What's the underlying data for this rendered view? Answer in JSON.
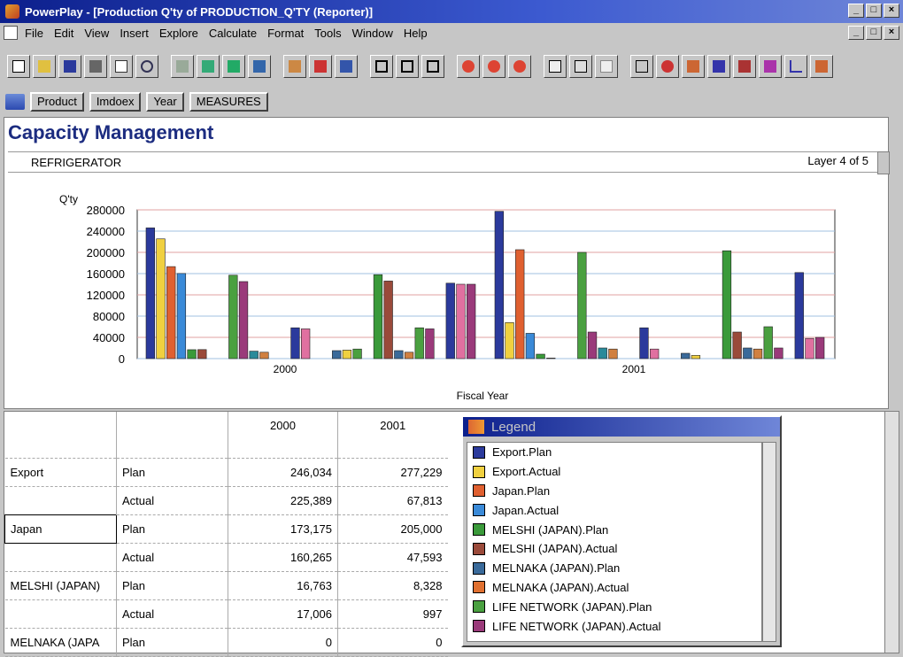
{
  "window": {
    "title": "PowerPlay - [Production Q'ty of PRODUCTION_Q'TY (Reporter)]",
    "controls": [
      "_",
      "×"
    ]
  },
  "menu": [
    "File",
    "Edit",
    "View",
    "Insert",
    "Explore",
    "Calculate",
    "Format",
    "Tools",
    "Window",
    "Help"
  ],
  "dimension_bar": {
    "dimensions": [
      "Product",
      "Imdoex",
      "Year",
      "MEASURES"
    ]
  },
  "report": {
    "title": "Capacity Management",
    "filter": "REFRIGERATOR",
    "layer": "Layer 4 of 5"
  },
  "colors": {
    "export_plan": "#2b3a9c",
    "export_actual": "#f0d040",
    "japan_plan": "#e06030",
    "japan_actual": "#3a8ad8",
    "melshi_plan": "#3a9a3a",
    "melshi_actual": "#9a4a3a",
    "melnaka_plan": "#3a6a9a",
    "melnaka_actual": "#e07030",
    "life_plan": "#4aa040",
    "life_actual": "#9a3a7a"
  },
  "chart_data": {
    "type": "bar",
    "xlabel": "Fiscal Year",
    "ylabel": "Q'ty",
    "ylim": [
      0,
      280000
    ],
    "yticks": [
      0,
      40000,
      80000,
      120000,
      160000,
      200000,
      240000,
      280000
    ],
    "yticks_labels": [
      "0",
      "40000",
      "80000",
      "120000",
      "160000",
      "200000",
      "240000",
      "280000"
    ],
    "categories": [
      "2000",
      "2001"
    ],
    "series": [
      {
        "values": [
          246034,
          277229
        ],
        "color": "#2b3a9c"
      },
      {
        "values": [
          225389,
          67813
        ],
        "color": "#f0d040"
      },
      {
        "values": [
          173175,
          205000
        ],
        "color": "#e06030"
      },
      {
        "values": [
          160265,
          47593
        ],
        "color": "#3a8ad8"
      },
      {
        "values": [
          16763,
          8328
        ],
        "color": "#3a9a3a"
      },
      {
        "values": [
          17006,
          997
        ],
        "color": "#9a4a3a"
      },
      {
        "values": [
          0,
          0
        ],
        "color": "#3a6a9a"
      },
      {
        "values": [
          0,
          0
        ],
        "color": "#e07030"
      },
      {
        "values": [
          157000,
          200000
        ],
        "color": "#4aa040"
      },
      {
        "values": [
          145000,
          50000
        ],
        "color": "#9a3a7a"
      },
      {
        "values": [
          14000,
          20000
        ],
        "color": "#2a8a9a"
      },
      {
        "values": [
          12000,
          18000
        ],
        "color": "#d08040"
      },
      {
        "values": [
          0,
          0
        ],
        "color": "#3a6a9a"
      },
      {
        "values": [
          0,
          0
        ],
        "color": "#e07030"
      },
      {
        "values": [
          58000,
          58000
        ],
        "color": "#2b3a9c"
      },
      {
        "values": [
          56000,
          18000
        ],
        "color": "#e070a0"
      },
      {
        "values": [
          0,
          0
        ],
        "color": "#3a6a9a"
      },
      {
        "values": [
          0,
          0
        ],
        "color": "#e07030"
      },
      {
        "values": [
          15000,
          10000
        ],
        "color": "#3a6a9a"
      },
      {
        "values": [
          16000,
          6000
        ],
        "color": "#f0d040"
      },
      {
        "values": [
          18000,
          0
        ],
        "color": "#4aa040"
      },
      {
        "values": [
          0,
          0
        ],
        "color": "#9a3a7a"
      },
      {
        "values": [
          158000,
          203000
        ],
        "color": "#3a9a3a"
      },
      {
        "values": [
          146000,
          50000
        ],
        "color": "#9a4a3a"
      },
      {
        "values": [
          15000,
          20000
        ],
        "color": "#3a6a9a"
      },
      {
        "values": [
          12000,
          18000
        ],
        "color": "#d08040"
      },
      {
        "values": [
          58000,
          60000
        ],
        "color": "#4aa040"
      },
      {
        "values": [
          56000,
          20000
        ],
        "color": "#9a3a7a"
      },
      {
        "values": [
          0,
          0
        ],
        "color": "#3a6a9a"
      },
      {
        "values": [
          142000,
          162000
        ],
        "color": "#2b3a9c"
      },
      {
        "values": [
          140000,
          38000
        ],
        "color": "#e070a0"
      },
      {
        "values": [
          140000,
          40000
        ],
        "color": "#9a3a7a"
      }
    ]
  },
  "table": {
    "columns": [
      "",
      "",
      "2000",
      "2001"
    ],
    "rows": [
      {
        "group": "Export",
        "measure": "Plan",
        "v2000": "246,034",
        "v2001": "277,229"
      },
      {
        "group": "",
        "measure": "Actual",
        "v2000": "225,389",
        "v2001": "67,813"
      },
      {
        "group": "Japan",
        "measure": "Plan",
        "v2000": "173,175",
        "v2001": "205,000"
      },
      {
        "group": "",
        "measure": "Actual",
        "v2000": "160,265",
        "v2001": "47,593"
      },
      {
        "group": "MELSHI (JAPAN)",
        "measure": "Plan",
        "v2000": "16,763",
        "v2001": "8,328"
      },
      {
        "group": "",
        "measure": "Actual",
        "v2000": "17,006",
        "v2001": "997"
      },
      {
        "group": "MELNAKA (JAPA",
        "measure": "Plan",
        "v2000": "0",
        "v2001": "0"
      }
    ]
  },
  "legend": {
    "title": "Legend",
    "items": [
      {
        "label": "Export.Plan",
        "color": "#2b3a9c"
      },
      {
        "label": "Export.Actual",
        "color": "#f0d040"
      },
      {
        "label": "Japan.Plan",
        "color": "#e06030"
      },
      {
        "label": "Japan.Actual",
        "color": "#3a8ad8"
      },
      {
        "label": "MELSHI (JAPAN).Plan",
        "color": "#3a9a3a"
      },
      {
        "label": "MELSHI (JAPAN).Actual",
        "color": "#9a4a3a"
      },
      {
        "label": "MELNAKA (JAPAN).Plan",
        "color": "#3a6a9a"
      },
      {
        "label": "MELNAKA (JAPAN).Actual",
        "color": "#e07030"
      },
      {
        "label": "LIFE NETWORK (JAPAN).Plan",
        "color": "#4aa040"
      },
      {
        "label": "LIFE NETWORK (JAPAN).Actual",
        "color": "#9a3a7a"
      }
    ]
  }
}
